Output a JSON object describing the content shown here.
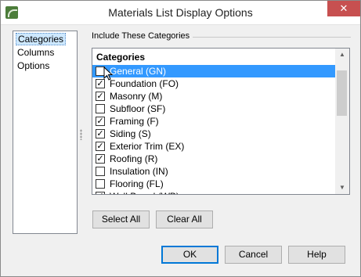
{
  "window": {
    "title": "Materials List Display Options"
  },
  "nav": {
    "items": [
      {
        "label": "Categories",
        "selected": true
      },
      {
        "label": "Columns",
        "selected": false
      },
      {
        "label": "Options",
        "selected": false
      }
    ]
  },
  "group": {
    "label": "Include These Categories"
  },
  "list": {
    "header": "Categories",
    "rows": [
      {
        "label": "General (GN)",
        "checked": false,
        "highlighted": true
      },
      {
        "label": "Foundation (FO)",
        "checked": true,
        "highlighted": false
      },
      {
        "label": "Masonry (M)",
        "checked": true,
        "highlighted": false
      },
      {
        "label": "Subfloor (SF)",
        "checked": false,
        "highlighted": false
      },
      {
        "label": "Framing (F)",
        "checked": true,
        "highlighted": false
      },
      {
        "label": "Siding (S)",
        "checked": true,
        "highlighted": false
      },
      {
        "label": "Exterior Trim (EX)",
        "checked": true,
        "highlighted": false
      },
      {
        "label": "Roofing (R)",
        "checked": true,
        "highlighted": false
      },
      {
        "label": "Insulation (IN)",
        "checked": false,
        "highlighted": false
      },
      {
        "label": "Flooring (FL)",
        "checked": false,
        "highlighted": false
      },
      {
        "label": "Wall Board (WB)",
        "checked": true,
        "highlighted": false
      }
    ]
  },
  "buttons": {
    "select_all": "Select All",
    "clear_all": "Clear All",
    "ok": "OK",
    "cancel": "Cancel",
    "help": "Help"
  },
  "icons": {
    "close": "close-icon",
    "check_mark": "✓",
    "scroll_up": "▲",
    "scroll_down": "▼"
  },
  "colors": {
    "highlight": "#3399ff",
    "nav_selected": "#cde8ff",
    "close_button": "#c75050",
    "default_button_border": "#0078d7"
  }
}
